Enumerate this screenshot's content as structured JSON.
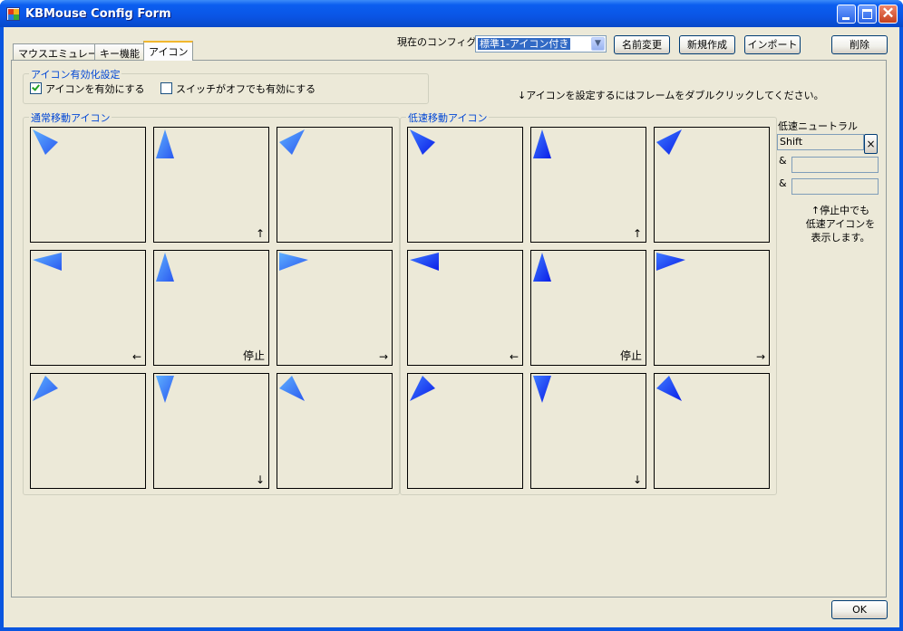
{
  "window": {
    "title": "KBMouse Config Form",
    "minimize_icon": "minimize-icon",
    "maximize_icon": "maximize-icon",
    "close_icon": "close-icon",
    "close_glyph": "✕"
  },
  "tabs": [
    {
      "label": "マウスエミュレート",
      "selected": false
    },
    {
      "label": "キー機能",
      "selected": false
    },
    {
      "label": "アイコン",
      "selected": true
    }
  ],
  "toolbar": {
    "config_label": "現在のコンフィグ",
    "config_value": "標準1-アイコン付き",
    "rename_label": "名前変更",
    "new_label": "新規作成",
    "import_label": "インポート",
    "delete_label": "削除"
  },
  "enable_group": {
    "title": "アイコン有効化設定",
    "enable_icons": {
      "label": "アイコンを有効にする",
      "checked": true
    },
    "enable_when_off": {
      "label": "スイッチがオフでも有効にする",
      "checked": false
    }
  },
  "hint": "↓アイコンを設定するにはフレームをダブルクリックしてください。",
  "normal_group": {
    "title": "通常移動アイコン",
    "cells": [
      {
        "label": "",
        "icon": "down-right-arrow-icon"
      },
      {
        "label": "↑",
        "icon": "up-arrow-icon"
      },
      {
        "label": "",
        "icon": "down-left-arrow-icon"
      },
      {
        "label": "←",
        "icon": "left-arrow-icon"
      },
      {
        "label": "停止",
        "icon": "up-arrow-icon"
      },
      {
        "label": "→",
        "icon": "right-arrow-icon"
      },
      {
        "label": "",
        "icon": "up-right-arrow-icon"
      },
      {
        "label": "↓",
        "icon": "down-arrow-icon"
      },
      {
        "label": "",
        "icon": "up-left-arrow-icon"
      }
    ]
  },
  "slow_group": {
    "title": "低速移動アイコン",
    "cells": [
      {
        "label": "",
        "icon": "down-right-arrow-icon"
      },
      {
        "label": "↑",
        "icon": "up-arrow-icon"
      },
      {
        "label": "",
        "icon": "down-left-arrow-icon"
      },
      {
        "label": "←",
        "icon": "left-arrow-icon"
      },
      {
        "label": "停止",
        "icon": "up-arrow-icon"
      },
      {
        "label": "→",
        "icon": "right-arrow-icon"
      },
      {
        "label": "",
        "icon": "up-right-arrow-icon"
      },
      {
        "label": "↓",
        "icon": "down-arrow-icon"
      },
      {
        "label": "",
        "icon": "up-left-arrow-icon"
      }
    ]
  },
  "slow_neutral": {
    "title": "低速ニュートラル",
    "key1": "Shift",
    "clear_label": "×",
    "amp1": "&",
    "key2": "",
    "amp2": "&",
    "key3": "",
    "note_line1": "↑停止中でも",
    "note_line2": "低速アイコンを",
    "note_line3": "表示します。"
  },
  "ok_label": "OK",
  "colors": {
    "normal_arrow_light": "#5fb1ff",
    "normal_arrow_dark": "#2a58f0",
    "slow_arrow_light": "#3f7cff",
    "slow_arrow_dark": "#0a1ee8"
  }
}
